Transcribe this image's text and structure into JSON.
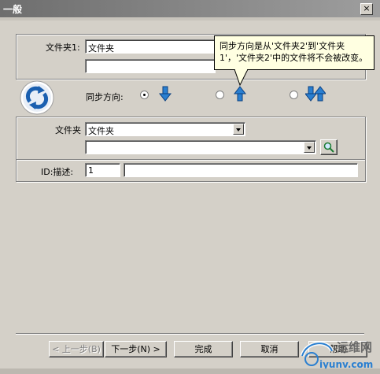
{
  "window": {
    "title": "一般",
    "close_glyph": "×"
  },
  "source": {
    "label": "文件夹1:",
    "value": "文件夹",
    "value2": ""
  },
  "direction": {
    "label": "同步方向:",
    "selected": "down",
    "options": [
      "down",
      "up",
      "both"
    ]
  },
  "tooltip": {
    "text": "同步方向是从'文件夹2'到'文件夹1'，'文件夹2'中的文件将不会被改变。"
  },
  "target": {
    "label": "文件夹",
    "combo1_value": "文件夹",
    "combo2_value": ""
  },
  "desc": {
    "label": "ID:描述:",
    "id_value": "1",
    "text_value": ""
  },
  "buttons": {
    "prev": "< 上一步(B)",
    "next": "下一步(N) >",
    "finish": "完成",
    "cancel": "取消",
    "help": "帮助"
  },
  "watermark": {
    "text": "运维网",
    "url_text": "iyunv.com"
  },
  "colors": {
    "face": "#d4d0c8",
    "arrow": "#2a7fd0",
    "tooltip_bg": "#ffffe1",
    "sync_icon": "#1a5fb0"
  }
}
